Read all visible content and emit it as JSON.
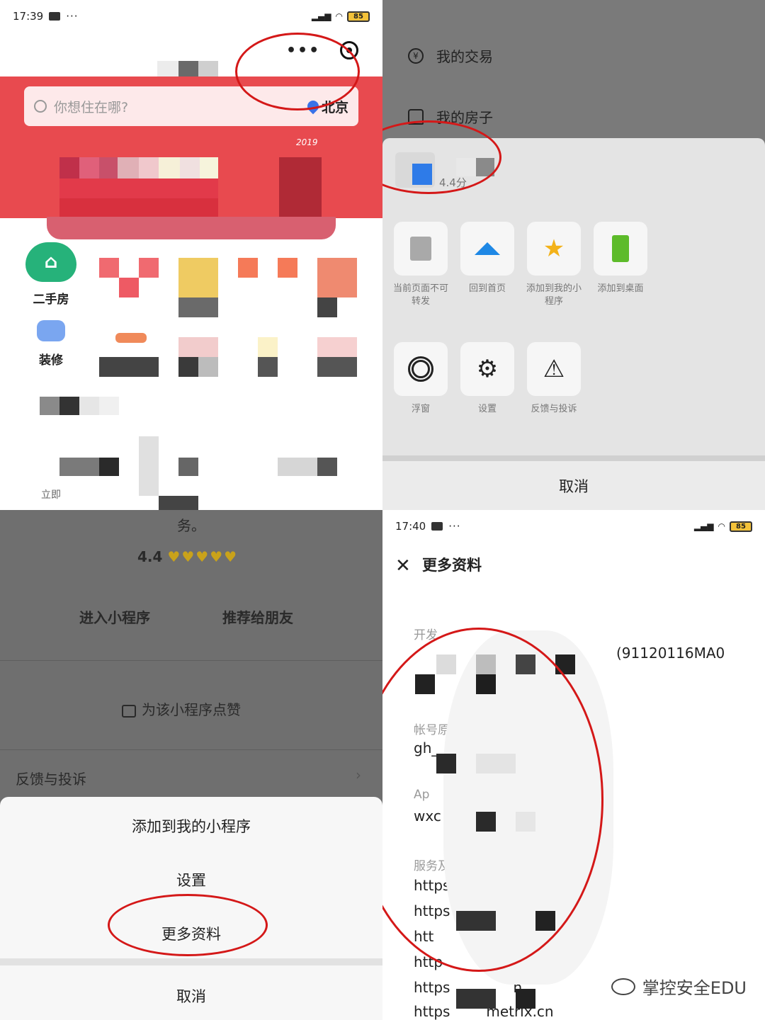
{
  "q1": {
    "status": {
      "time": "17:39",
      "dots": "···",
      "battery": "85"
    },
    "capsule_more": "•••",
    "search_placeholder": "你想住在哪?",
    "city": "北京",
    "banner_year": "2019",
    "categories": [
      "二手房",
      "装修"
    ],
    "partial_label": "立即"
  },
  "q2": {
    "menu": [
      "我的交易",
      "我的房子"
    ],
    "score": "4.4分",
    "actions_row1": [
      {
        "label": "当前页面不可转发",
        "icon": "share-icon"
      },
      {
        "label": "回到首页",
        "icon": "home-icon"
      },
      {
        "label": "添加到我的小程序",
        "icon": "star-icon"
      },
      {
        "label": "添加到桌面",
        "icon": "desktop-icon"
      }
    ],
    "actions_row2": [
      {
        "label": "浮窗",
        "icon": "float-window-icon"
      },
      {
        "label": "设置",
        "icon": "gear-icon"
      },
      {
        "label": "反馈与投诉",
        "icon": "warning-icon"
      }
    ],
    "cancel": "取消"
  },
  "q3": {
    "desc_tail": "务。",
    "rating": "4.4",
    "enter": "进入小程序",
    "recommend": "推荐给朋友",
    "like": "为该小程序点赞",
    "feedback": "反馈与投诉",
    "options": [
      "添加到我的小程序",
      "设置",
      "更多资料"
    ],
    "cancel": "取消"
  },
  "q4": {
    "status": {
      "time": "17:40",
      "dots": "···",
      "battery": "85"
    },
    "title": "更多资料",
    "fields": [
      {
        "label": "开发",
        "value": "(91120116MA0"
      },
      {
        "label": "帐号原",
        "value": "gh_"
      },
      {
        "label": "Ap",
        "value": "wxc          67d98"
      },
      {
        "label": "服务及",
        "value": "https://ac"
      }
    ],
    "domains": [
      "https          ia.com",
      "htt                   n",
      "http",
      "https              n",
      "https        metrix.cn"
    ],
    "watermark": "掌控安全EDU"
  }
}
